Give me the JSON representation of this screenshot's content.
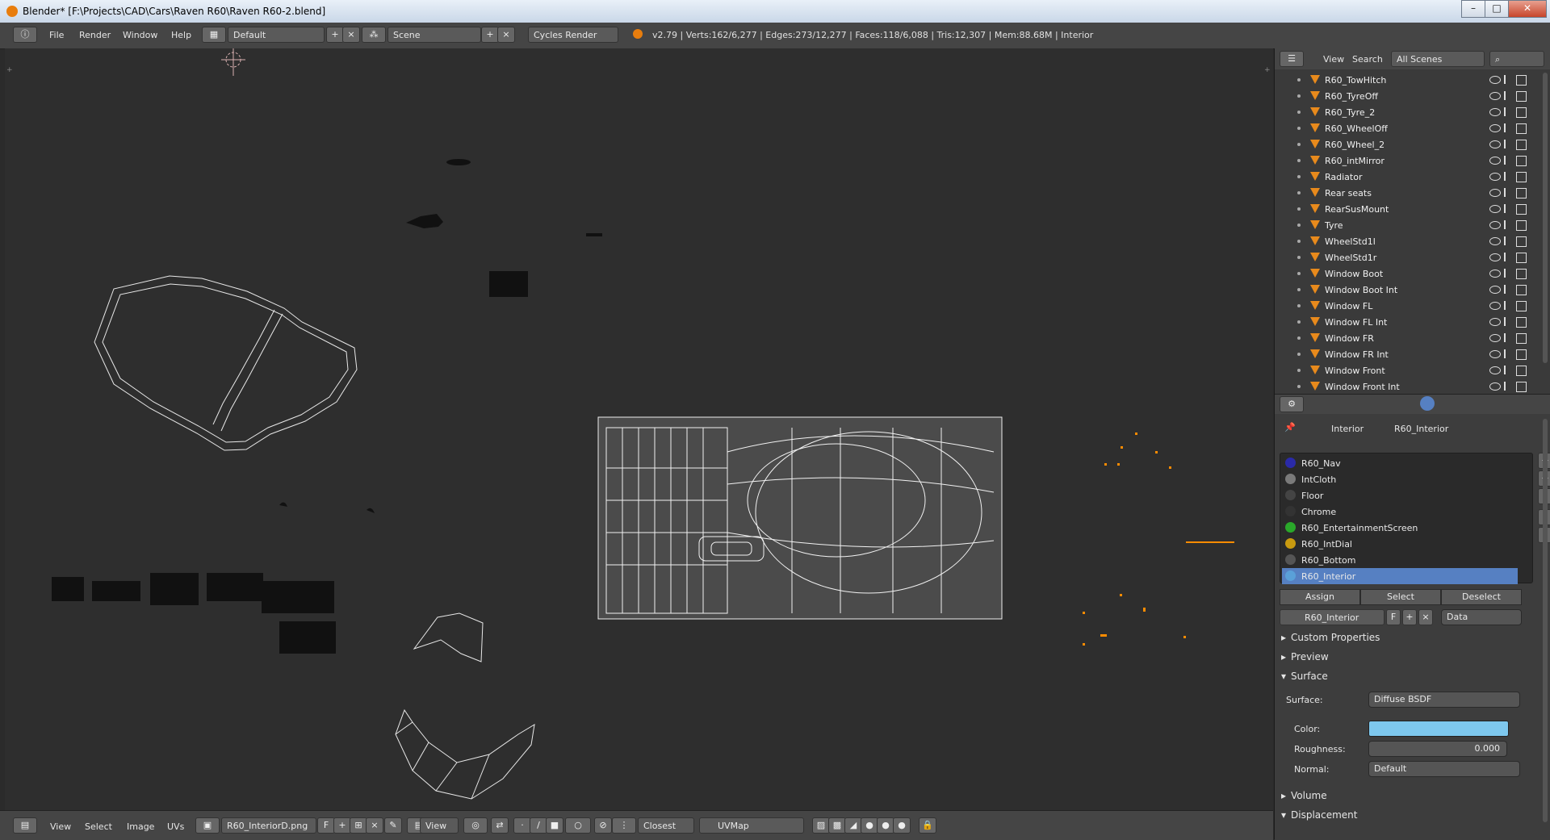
{
  "window": {
    "title": "Blender* [F:\\Projects\\CAD\\Cars\\Raven R60\\Raven R60-2.blend]",
    "min": "–",
    "max": "□",
    "close": "✕"
  },
  "topbar": {
    "menus": [
      "File",
      "Render",
      "Window",
      "Help"
    ],
    "layout": "Default",
    "scene": "Scene",
    "engine": "Cycles Render",
    "stats": "v2.79 | Verts:162/6,277 | Edges:273/12,277 | Faces:118/6,088 | Tris:12,307 | Mem:88.68M | Interior"
  },
  "outliner": {
    "menus": [
      "View",
      "Search"
    ],
    "scope": "All Scenes",
    "items": [
      "R60_TowHitch",
      "R60_TyreOff",
      "R60_Tyre_2",
      "R60_WheelOff",
      "R60_Wheel_2",
      "R60_intMirror",
      "Radiator",
      "Rear seats",
      "RearSusMount",
      "Tyre",
      "WheelStd1l",
      "WheelStd1r",
      "Window Boot",
      "Window Boot Int",
      "Window FL",
      "Window FL Int",
      "Window FR",
      "Window FR Int",
      "Window Front",
      "Window Front Int"
    ]
  },
  "properties": {
    "breadcrumb": {
      "object": "Interior",
      "material": "R60_Interior"
    },
    "materials": [
      {
        "name": "R60_Nav",
        "color": "#2a2aa8"
      },
      {
        "name": "IntCloth",
        "color": "#7a7a7a"
      },
      {
        "name": "Floor",
        "color": "#444444"
      },
      {
        "name": "Chrome",
        "color": "#333333"
      },
      {
        "name": "R60_EntertainmentScreen",
        "color": "#2aa82a"
      },
      {
        "name": "R60_IntDial",
        "color": "#c89a10"
      },
      {
        "name": "R60_Bottom",
        "color": "#555555"
      },
      {
        "name": "R60_Interior",
        "color": "#5aa0d8"
      }
    ],
    "selected_material": "R60_Interior",
    "buttons": {
      "assign": "Assign",
      "select": "Select",
      "deselect": "Deselect"
    },
    "material_field": "R60_Interior",
    "f_label": "F",
    "link": "Data",
    "sections": {
      "custom": "Custom Properties",
      "preview": "Preview",
      "surface": "Surface",
      "volume": "Volume",
      "displacement": "Displacement"
    },
    "surface": {
      "surface_label": "Surface:",
      "surface_value": "Diffuse BSDF",
      "color_label": "Color:",
      "color_value": "#7ec8ee",
      "roughness_label": "Roughness:",
      "roughness_value": "0.000",
      "normal_label": "Normal:",
      "normal_value": "Default"
    }
  },
  "bottombar": {
    "menus": [
      "View",
      "Select",
      "Image",
      "UVs"
    ],
    "image": "R60_InteriorD.png",
    "f_label": "F",
    "view": "View",
    "snap": "Closest",
    "uvmap": "UVMap"
  }
}
